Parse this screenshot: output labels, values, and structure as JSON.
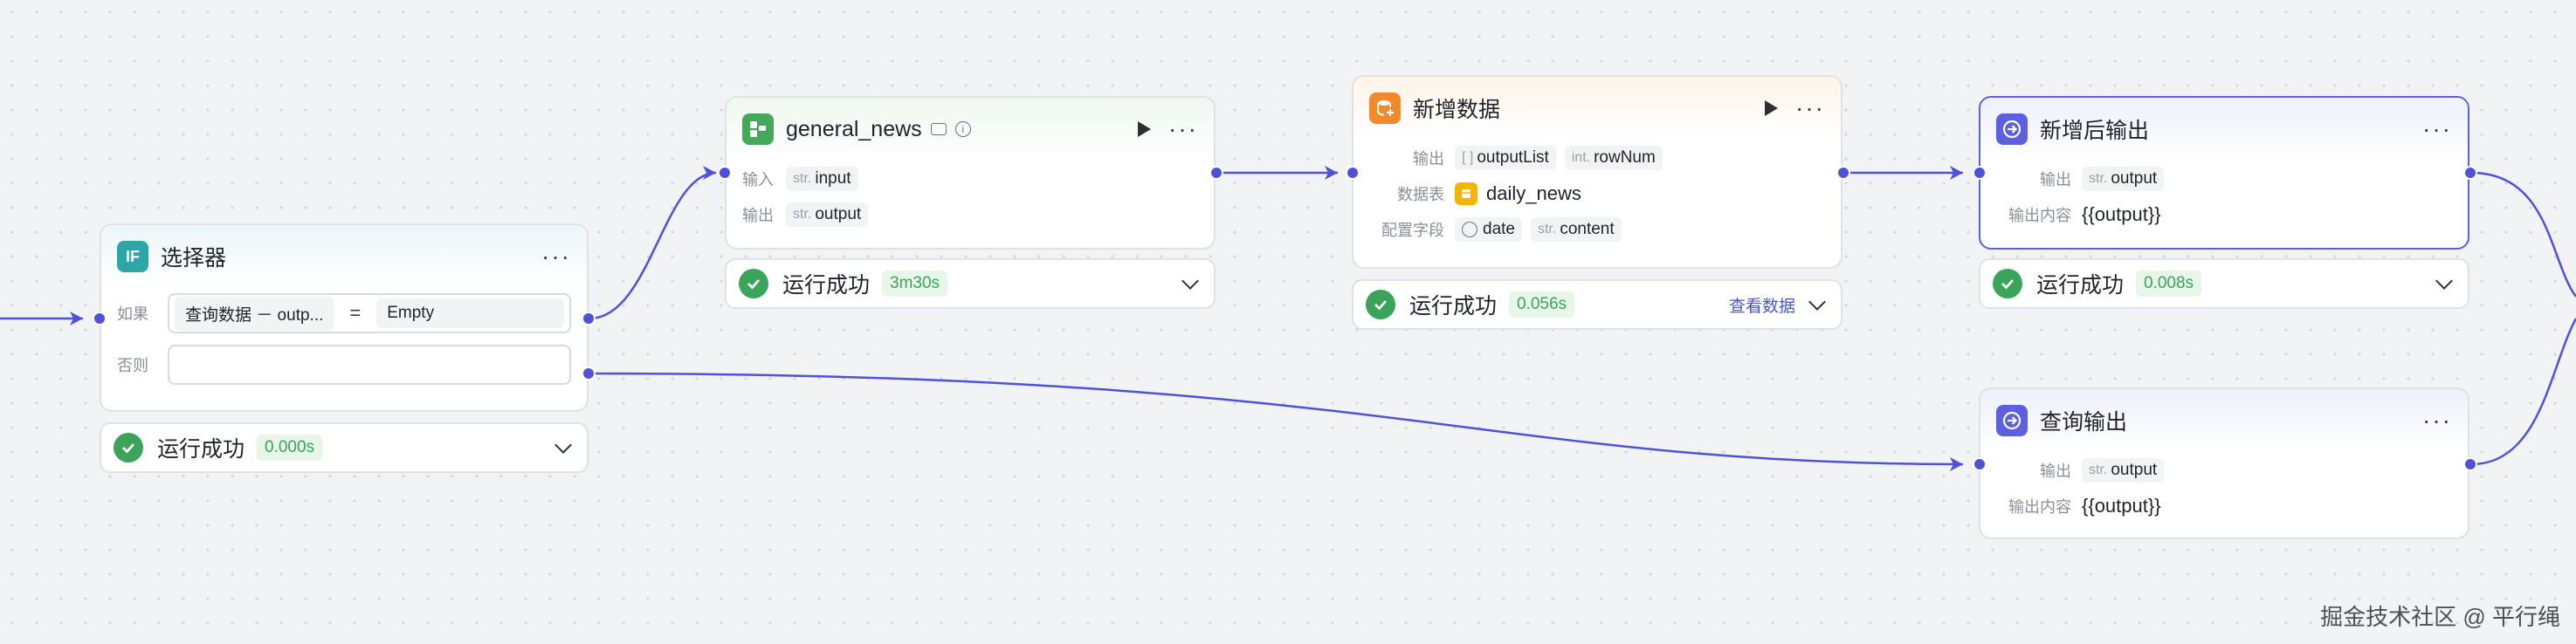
{
  "colors": {
    "accent": "#5b5fe0",
    "success": "#3aa55a",
    "edge": "#4f52d9"
  },
  "selector": {
    "title": "选择器",
    "icon": "if-icon",
    "icon_text": "IF",
    "if_label": "如果",
    "if_left": "查询数据 － outp...",
    "if_op": "=",
    "if_right": "Empty",
    "else_label": "否则",
    "else_value": "",
    "status": "运行成功",
    "duration": "0.000s"
  },
  "general_news": {
    "title": "general_news",
    "input_label": "输入",
    "input_type": "str.",
    "input_name": "input",
    "output_label": "输出",
    "output_type": "str.",
    "output_name": "output",
    "status": "运行成功",
    "duration": "3m30s"
  },
  "add_data": {
    "title": "新增数据",
    "output_label": "输出",
    "out1_type": "[ ]",
    "out1_name": "outputList",
    "out2_type": "int.",
    "out2_name": "rowNum",
    "table_label": "数据表",
    "table_name": "daily_news",
    "fields_label": "配置字段",
    "field1_name": "date",
    "field2_type": "str.",
    "field2_name": "content",
    "status": "运行成功",
    "duration": "0.056s",
    "view_data": "查看数据"
  },
  "after_add_output": {
    "title": "新增后输出",
    "output_label": "输出",
    "output_type": "str.",
    "output_name": "output",
    "content_label": "输出内容",
    "content_value": "{{output}}",
    "status": "运行成功",
    "duration": "0.008s"
  },
  "query_output": {
    "title": "查询输出",
    "output_label": "输出",
    "output_type": "str.",
    "output_name": "output",
    "content_label": "输出内容",
    "content_value": "{{output}}"
  },
  "watermark": "掘金技术社区 @ 平行绳"
}
